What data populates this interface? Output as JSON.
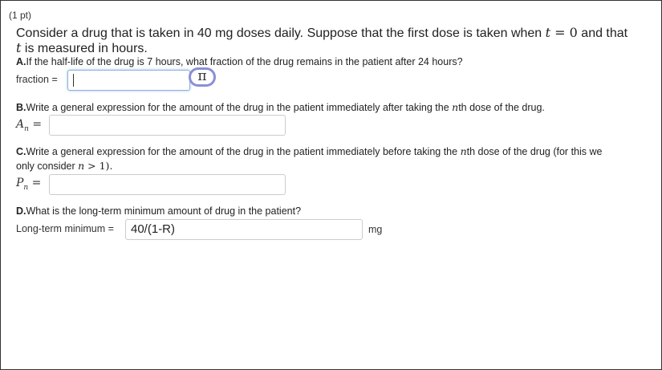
{
  "points": "(1 pt)",
  "intro": {
    "line1_a": "Consider a drug that is taken in 40 mg doses daily. Suppose that the first dose is taken when ",
    "t_var": "t",
    "equals_zero": " = 0",
    "line1_b": " and that",
    "t_var2": "t",
    "line2": " is measured in hours."
  },
  "partA": {
    "letter": "A.",
    "text": "If the half-life of the drug is 7 hours, what fraction of the drug remains in the patient after 24 hours?",
    "label": "fraction =",
    "value": "",
    "pi_icon": "π"
  },
  "partB": {
    "letter": "B.",
    "text_a": "Write a general expression for the amount of the drug in the patient immediately after taking the ",
    "n": "n",
    "text_b": "th dose of the drug.",
    "label_var": "A",
    "label_sub": "n",
    "label_eq": " =",
    "value": ""
  },
  "partC": {
    "letter": "C.",
    "text_a": "Write a general expression for the amount of the drug in the patient immediately before taking the ",
    "n": "n",
    "text_b": "th dose of the drug (for this we",
    "text_c": "only consider ",
    "n2": "n",
    "cond": " > 1).",
    "label_var": "P",
    "label_sub": "n",
    "label_eq": " =",
    "value": ""
  },
  "partD": {
    "letter": "D.",
    "text": "What is the long-term minimum amount of drug in the patient?",
    "label": "Long-term minimum =",
    "value": "40/(1-R)",
    "unit": "mg"
  }
}
